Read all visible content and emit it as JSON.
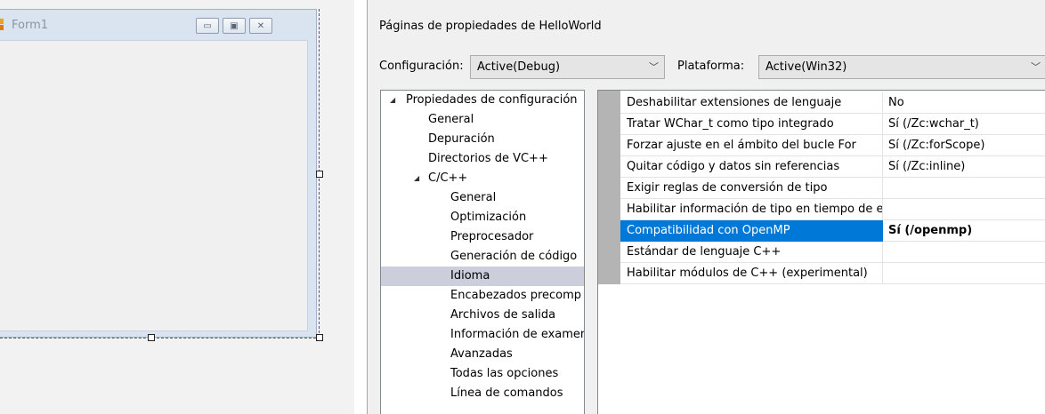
{
  "form1": {
    "title": "Form1"
  },
  "dialog": {
    "title": "Páginas de propiedades de HelloWorld",
    "configuration": {
      "label": "Configuración:",
      "value": "Active(Debug)"
    },
    "platform": {
      "label": "Plataforma:",
      "value": "Active(Win32)"
    },
    "tree": [
      {
        "label": "Propiedades de configuración",
        "expanded": true
      },
      {
        "label": "General"
      },
      {
        "label": "Depuración"
      },
      {
        "label": "Directorios de VC++"
      },
      {
        "label": "C/C++",
        "expanded": true
      },
      {
        "label": "General"
      },
      {
        "label": "Optimización"
      },
      {
        "label": "Preprocesador"
      },
      {
        "label": "Generación de código"
      },
      {
        "label": "Idioma",
        "selected": true
      },
      {
        "label": "Encabezados precomp"
      },
      {
        "label": "Archivos de salida"
      },
      {
        "label": "Información de examen"
      },
      {
        "label": "Avanzadas"
      },
      {
        "label": "Todas las opciones"
      },
      {
        "label": "Línea de comandos"
      }
    ],
    "properties": [
      {
        "name": "Deshabilitar extensiones de lenguaje",
        "value": "No"
      },
      {
        "name": "Tratar WChar_t como tipo integrado",
        "value": "Sí (/Zc:wchar_t)"
      },
      {
        "name": "Forzar ajuste en el ámbito del bucle For",
        "value": "Sí (/Zc:forScope)"
      },
      {
        "name": "Quitar código y datos sin referencias",
        "value": "Sí (/Zc:inline)"
      },
      {
        "name": "Exigir reglas de conversión de tipo",
        "value": ""
      },
      {
        "name": "Habilitar información de tipo en tiempo de ejecución",
        "value": ""
      },
      {
        "name": "Compatibilidad con OpenMP",
        "value": "Sí (/openmp)",
        "selected": true
      },
      {
        "name": "Estándar de lenguaje C++",
        "value": ""
      },
      {
        "name": "Habilitar módulos de C++ (experimental)",
        "value": ""
      }
    ]
  }
}
